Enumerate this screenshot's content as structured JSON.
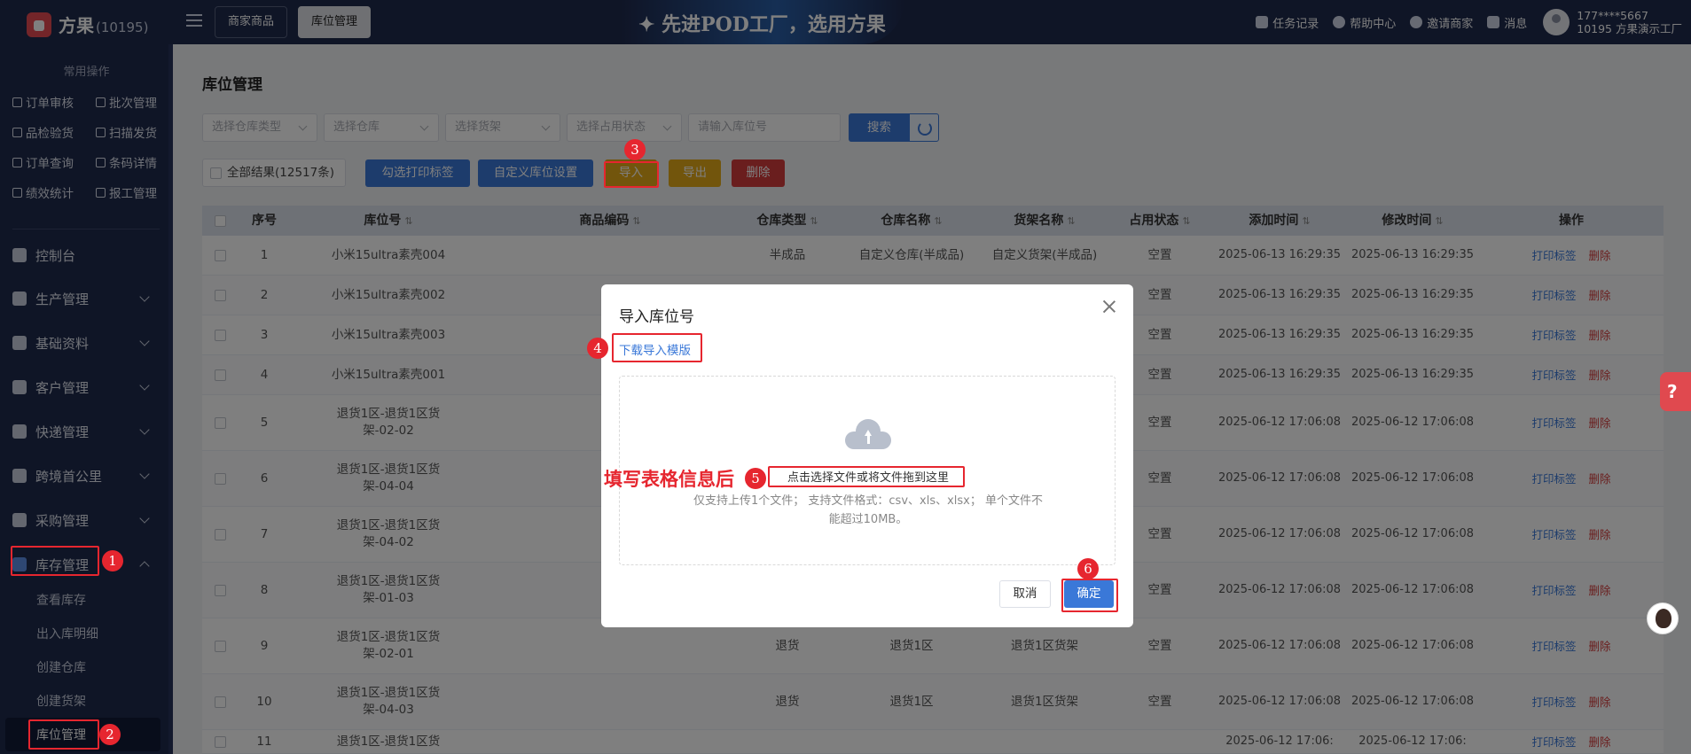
{
  "topbar": {
    "brand": "方果",
    "brand_id": "(10195)",
    "tabs": [
      "商家商品",
      "库位管理"
    ],
    "slogan": "✦ 先进POD工厂，选用方果",
    "links": [
      "任务记录",
      "帮助中心",
      "邀请商家",
      "消息"
    ],
    "user_phone": "177****5667",
    "user_org": "10195 方果演示工厂"
  },
  "sidebar": {
    "common_title": "常用操作",
    "quick": [
      "订单审核",
      "批次管理",
      "品检验货",
      "扫描发货",
      "订单查询",
      "条码详情",
      "绩效统计",
      "报工管理"
    ],
    "menu": [
      "控制台",
      "生产管理",
      "基础资料",
      "客户管理",
      "快递管理",
      "跨境首公里",
      "采购管理",
      "库存管理"
    ],
    "submenu": [
      "查看库存",
      "出入库明细",
      "创建仓库",
      "创建货架",
      "库位管理"
    ]
  },
  "page": {
    "title": "库位管理",
    "filters": [
      "选择仓库类型",
      "选择仓库",
      "选择货架",
      "选择占用状态"
    ],
    "search_placeholder": "请输入库位号",
    "search_btn": "搜索",
    "all_results": "全部结果(12517条)",
    "actions": {
      "print": "勾选打印标签",
      "custom": "自定义库位设置",
      "import": "导入",
      "export": "导出",
      "delete": "删除"
    }
  },
  "table": {
    "headers": [
      "序号",
      "库位号",
      "商品编码",
      "仓库类型",
      "仓库名称",
      "货架名称",
      "占用状态",
      "添加时间",
      "修改时间",
      "操作"
    ],
    "op_print": "打印标签",
    "op_delete": "删除",
    "rows": [
      {
        "no": "1",
        "code": "小米15ultra素壳004",
        "sku": "",
        "type": "半成品",
        "wh": "自定义仓库(半成品)",
        "shelf": "自定义货架(半成品)",
        "status": "空置",
        "added": "2025-06-13 16:29:35",
        "modified": "2025-06-13 16:29:35"
      },
      {
        "no": "2",
        "code": "小米15ultra素壳002",
        "sku": "",
        "type": "",
        "wh": "",
        "shelf": "",
        "status": "空置",
        "added": "2025-06-13 16:29:35",
        "modified": "2025-06-13 16:29:35"
      },
      {
        "no": "3",
        "code": "小米15ultra素壳003",
        "sku": "",
        "type": "",
        "wh": "",
        "shelf": "",
        "status": "空置",
        "added": "2025-06-13 16:29:35",
        "modified": "2025-06-13 16:29:35"
      },
      {
        "no": "4",
        "code": "小米15ultra素壳001",
        "sku": "",
        "type": "",
        "wh": "",
        "shelf": "",
        "status": "空置",
        "added": "2025-06-13 16:29:35",
        "modified": "2025-06-13 16:29:35"
      },
      {
        "no": "5",
        "code": "退货1区-退货1区货架-02-02",
        "sku": "",
        "type": "",
        "wh": "",
        "shelf": "",
        "status": "空置",
        "added": "2025-06-12 17:06:08",
        "modified": "2025-06-12 17:06:08"
      },
      {
        "no": "6",
        "code": "退货1区-退货1区货架-04-04",
        "sku": "",
        "type": "",
        "wh": "",
        "shelf": "",
        "status": "空置",
        "added": "2025-06-12 17:06:08",
        "modified": "2025-06-12 17:06:08"
      },
      {
        "no": "7",
        "code": "退货1区-退货1区货架-04-02",
        "sku": "",
        "type": "",
        "wh": "",
        "shelf": "",
        "status": "空置",
        "added": "2025-06-12 17:06:08",
        "modified": "2025-06-12 17:06:08"
      },
      {
        "no": "8",
        "code": "退货1区-退货1区货架-01-03",
        "sku": "",
        "type": "",
        "wh": "",
        "shelf": "",
        "status": "空置",
        "added": "2025-06-12 17:06:08",
        "modified": "2025-06-12 17:06:08"
      },
      {
        "no": "9",
        "code": "退货1区-退货1区货架-02-01",
        "sku": "",
        "type": "退货",
        "wh": "退货1区",
        "shelf": "退货1区货架",
        "status": "空置",
        "added": "2025-06-12 17:06:08",
        "modified": "2025-06-12 17:06:08"
      },
      {
        "no": "10",
        "code": "退货1区-退货1区货架-04-03",
        "sku": "",
        "type": "退货",
        "wh": "退货1区",
        "shelf": "退货1区货架",
        "status": "空置",
        "added": "2025-06-12 17:06:08",
        "modified": "2025-06-12 17:06:08"
      },
      {
        "no": "11",
        "code": "退货1区-退货1区货",
        "sku": "",
        "type": "",
        "wh": "",
        "shelf": "",
        "status": "",
        "added": "2025-06-12 17:06:",
        "modified": "2025-06-12 17:06:"
      }
    ]
  },
  "modal": {
    "title": "导入库位号",
    "download": "下载导入模版",
    "upload_main": "点击选择文件或将文件拖到这里",
    "upload_tip": "仅支持上传1个文件； 支持文件格式：csv、xls、xlsx； 单个文件不能超过10MB。",
    "cancel": "取消",
    "ok": "确定"
  },
  "annotation": {
    "fill_text": "填写表格信息后",
    "steps": [
      "1",
      "2",
      "3",
      "4",
      "5",
      "6"
    ],
    "color": "#e6262f"
  },
  "fab": {
    "help": "?"
  }
}
